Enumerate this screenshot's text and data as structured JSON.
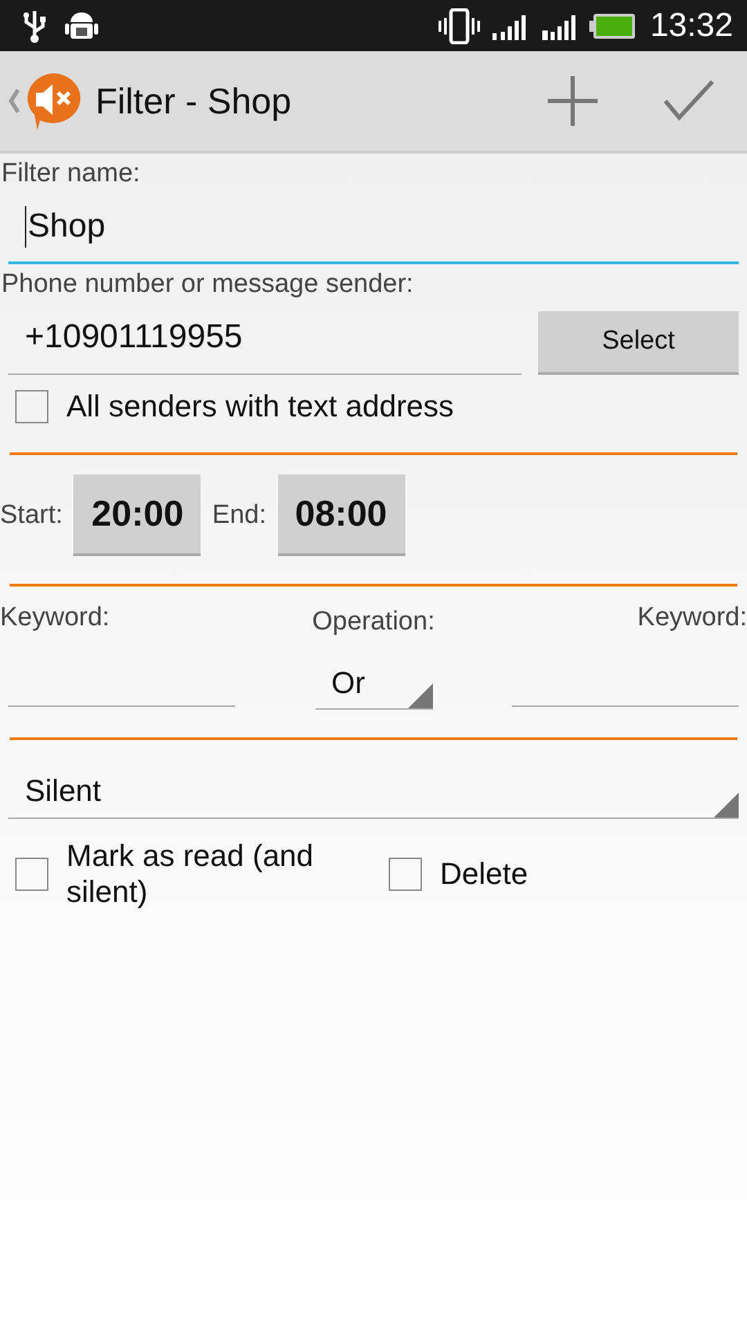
{
  "status_bar": {
    "time": "13:32"
  },
  "action_bar": {
    "title": "Filter - Shop"
  },
  "filter_name": {
    "label": "Filter name:",
    "value": "Shop",
    "focused": true
  },
  "sender": {
    "label": "Phone number or message sender:",
    "value": "+10901119955",
    "button": "Select"
  },
  "text_senders": {
    "label": "All senders with text address",
    "checked": false
  },
  "time_range": {
    "start_label": "Start:",
    "start": "20:00",
    "end_label": "End:",
    "end": "08:00"
  },
  "keywords": {
    "left_label": "Keyword:",
    "operation_label": "Operation:",
    "operation": "Or",
    "right_label": "Keyword:"
  },
  "action": {
    "value": "Silent"
  },
  "options": [
    {
      "label": "Mark as read (and silent)",
      "checked": false
    },
    {
      "label": "Delete",
      "checked": false
    }
  ]
}
